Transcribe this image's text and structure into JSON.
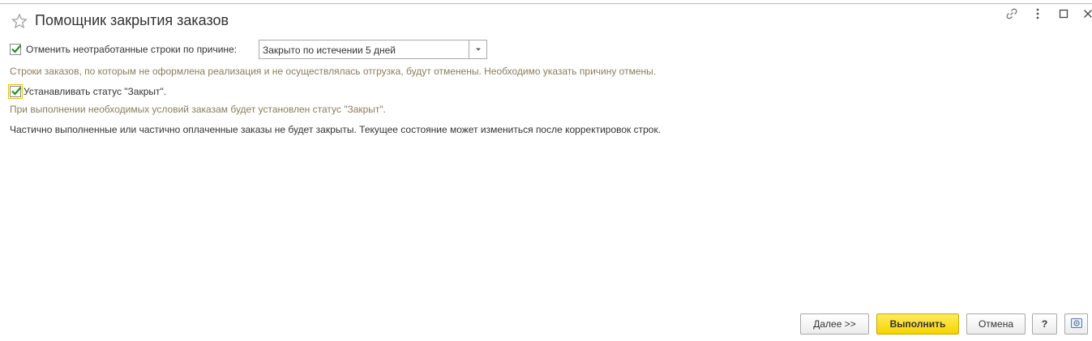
{
  "window": {
    "title": "Помощник закрытия заказов"
  },
  "options": {
    "cancel_rows": {
      "checked": true,
      "label": "Отменить неотработанные строки по причине:",
      "reason_value": "Закрыто по истечении 5 дней",
      "hint": "Строки заказов, по которым не оформлена реализация и не осуществлялась отгрузка, будут отменены. Необходимо указать причину отмены."
    },
    "set_closed_status": {
      "checked": true,
      "label": "Устанавливать статус \"Закрыт\".",
      "hint": "При выполнении необходимых условий заказам будет установлен статус \"Закрыт\"."
    },
    "note": "Частично выполненные или частично оплаченные заказы не будет закрыты. Текущее состояние может измениться после корректировок строк."
  },
  "footer": {
    "next_label": "Далее >>",
    "execute_label": "Выполнить",
    "cancel_label": "Отмена",
    "help_label": "?"
  },
  "colors": {
    "accent_yellow": "#f5d400",
    "hint_text": "#8b7d5b",
    "check_green": "#2a8a2a"
  },
  "icons": [
    "star-icon",
    "link-icon",
    "more-icon",
    "maximize-icon",
    "close-icon",
    "dropdown-arrow-icon",
    "checkmark-icon",
    "settings-icon"
  ]
}
